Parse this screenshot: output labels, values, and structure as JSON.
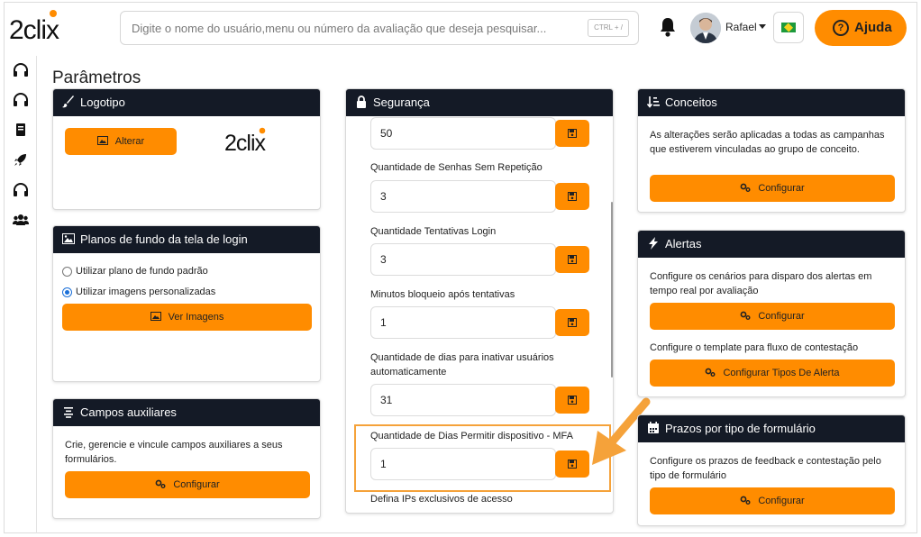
{
  "app": {
    "logo_text": "2clix"
  },
  "search": {
    "placeholder": "Digite o nome do usuário,menu ou número da avaliação que deseja pesquisar...",
    "shortcut": "CTRL + /"
  },
  "user": {
    "name": "Rafael"
  },
  "help": {
    "label": "Ajuda"
  },
  "page": {
    "title": "Parâmetros"
  },
  "sidebar": {
    "icons": [
      "headset-icon",
      "headset-icon",
      "book-icon",
      "rocket-icon",
      "headset-icon",
      "users-icon"
    ]
  },
  "logotipo": {
    "title": "Logotipo",
    "button": "Alterar",
    "preview_text": "2clix"
  },
  "planos": {
    "title": "Planos de fundo da tela de login",
    "option_default": "Utilizar plano de fundo padrão",
    "option_custom": "Utilizar imagens personalizadas",
    "selected": "custom",
    "button": "Ver Imagens"
  },
  "campos": {
    "title": "Campos auxiliares",
    "description": "Crie, gerencie e vincule campos auxiliares a seus formulários.",
    "button": "Configurar"
  },
  "seguranca": {
    "title": "Segurança",
    "fields": [
      {
        "label": "",
        "value": "50"
      },
      {
        "label": "Quantidade de Senhas Sem Repetição",
        "value": "3"
      },
      {
        "label": "Quantidade Tentativas Login",
        "value": "3"
      },
      {
        "label": "Minutos bloqueio após tentativas",
        "value": "1"
      },
      {
        "label": "Quantidade de dias para inativar usuários automaticamente",
        "value": "31"
      },
      {
        "label": "Quantidade de Dias Permitir dispositivo - MFA",
        "value": "1"
      }
    ],
    "footer_label": "Defina IPs exclusivos de acesso"
  },
  "conceitos": {
    "title": "Conceitos",
    "description": "As alterações serão aplicadas a todas as campanhas que estiverem vinculadas ao grupo de conceito.",
    "button": "Configurar"
  },
  "alertas": {
    "title": "Alertas",
    "description1": "Configure os cenários para disparo dos alertas em tempo real por avaliação",
    "button1": "Configurar",
    "description2": "Configure o template para fluxo de contestação",
    "button2": "Configurar Tipos De Alerta"
  },
  "prazos": {
    "title": "Prazos por tipo de formulário",
    "description": "Configure os prazos de feedback e contestação pelo tipo de formulário",
    "button": "Configurar"
  },
  "colors": {
    "accent": "#ff8c00",
    "header": "#141a26",
    "highlight": "#f5a23a"
  }
}
